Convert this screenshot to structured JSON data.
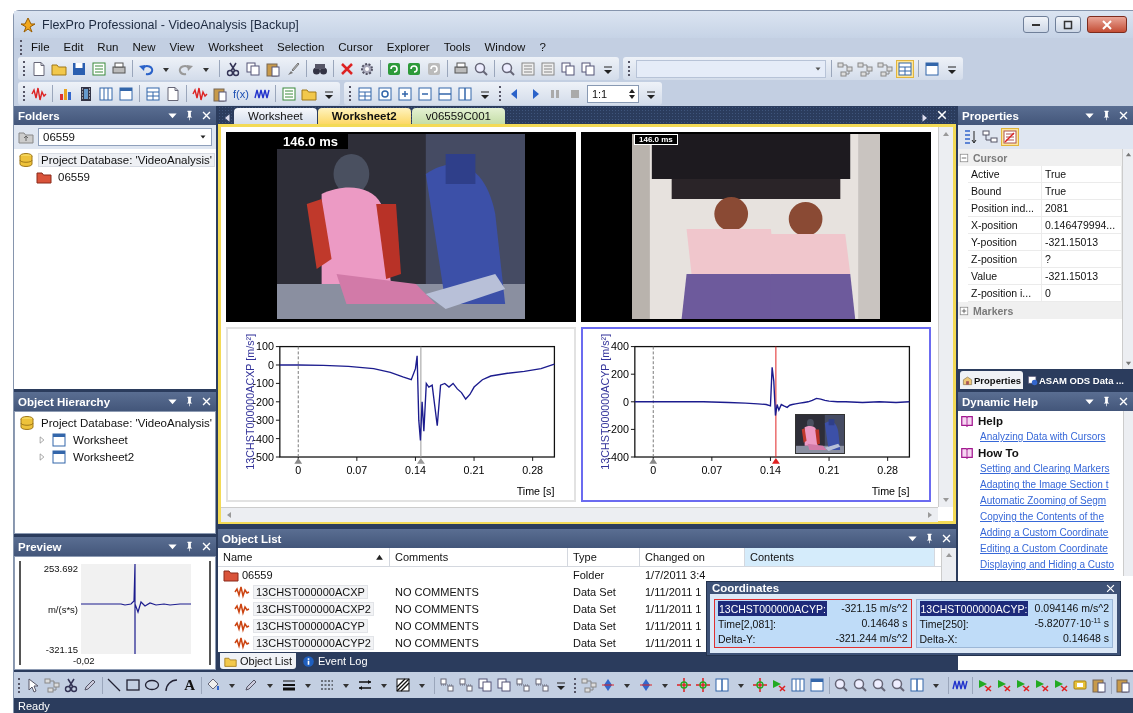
{
  "window": {
    "title": "FlexPro Professional - VideoAnalysis [Backup]"
  },
  "menu": [
    "File",
    "Edit",
    "Run",
    "New",
    "View",
    "Worksheet",
    "Selection",
    "Cursor",
    "Explorer",
    "Tools",
    "Window",
    "?"
  ],
  "toolbar": {
    "formula_button": "f(x)",
    "zoom_ratio": "1:1"
  },
  "folders": {
    "title": "Folders",
    "path": "06559",
    "tree": [
      {
        "label": "Project Database: 'VideoAnalysis'",
        "kind": "database",
        "selected": true,
        "children": [
          {
            "label": "06559",
            "kind": "folder",
            "selected": false
          }
        ]
      }
    ]
  },
  "object_hierarchy": {
    "title": "Object Hierarchy",
    "tree": [
      {
        "label": "Project Database: 'VideoAnalysis'",
        "kind": "database",
        "children": [
          {
            "label": "Worksheet",
            "kind": "worksheet",
            "expanded": false
          },
          {
            "label": "Worksheet2",
            "kind": "worksheet",
            "expanded": false
          }
        ]
      }
    ]
  },
  "preview": {
    "title": "Preview",
    "y_max": "253.692",
    "y_unit": "m/(s*s)",
    "y_min": "-321.15",
    "x_min": "-0,02"
  },
  "document_tabs": [
    {
      "label": "Worksheet",
      "kind": "worksheet",
      "selected": false
    },
    {
      "label": "Worksheet2",
      "kind": "worksheet",
      "selected": true
    },
    {
      "label": "v06559C001",
      "kind": "video",
      "selected": false
    }
  ],
  "worksheet": {
    "videos": [
      {
        "time": "146.0 ms"
      },
      {
        "time": "146.0 ms"
      }
    ],
    "charts": [
      {
        "selected": false,
        "chart_data": {
          "type": "line",
          "xlabel": "Time [s]",
          "ylabel": "13CHST000000ACXP [m/s²]",
          "xlim": [
            -0.022,
            0.306
          ],
          "ylim": [
            -500,
            100
          ],
          "xticks": [
            0,
            0.07,
            0.14,
            0.21,
            0.28
          ],
          "yticks": [
            -500,
            -400,
            -300,
            -200,
            -100,
            0,
            100
          ],
          "x": [
            -0.022,
            0,
            0.03,
            0.06,
            0.09,
            0.11,
            0.125,
            0.135,
            0.14,
            0.142,
            0.144,
            0.146,
            0.148,
            0.15,
            0.153,
            0.156,
            0.16,
            0.163,
            0.166,
            0.17,
            0.175,
            0.18,
            0.185,
            0.19,
            0.195,
            0.2,
            0.205,
            0.21,
            0.22,
            0.23,
            0.25,
            0.27,
            0.29,
            0.306
          ],
          "ref_lines": [
            {
              "axis": "x",
              "value": 0.1465
            }
          ],
          "series": [
            {
              "color": "#1c1c8e",
              "values": [
                0,
                0,
                -2,
                -8,
                -20,
                -40,
                -65,
                -80,
                -20,
                50,
                -300,
                -410,
                -200,
                -360,
                -100,
                -120,
                -110,
                -220,
                -330,
                -110,
                -100,
                -120,
                -100,
                -130,
                -150,
                -185,
                -160,
                -120,
                -80,
                -60,
                -45,
                -35,
                -20,
                5
              ]
            }
          ]
        }
      },
      {
        "selected": true,
        "chart_data": {
          "type": "line",
          "xlabel": "Time [s]",
          "ylabel": "13CHST000000ACYP [m/s²]",
          "xlim": [
            -0.022,
            0.306
          ],
          "ylim": [
            -400,
            400
          ],
          "xticks": [
            0,
            0.07,
            0.14,
            0.21,
            0.28
          ],
          "yticks": [
            -400,
            -200,
            0,
            200,
            400
          ],
          "x": [
            -0.022,
            0,
            0.03,
            0.06,
            0.09,
            0.11,
            0.125,
            0.135,
            0.14,
            0.142,
            0.144,
            0.146,
            0.148,
            0.15,
            0.153,
            0.156,
            0.16,
            0.163,
            0.166,
            0.17,
            0.175,
            0.18,
            0.185,
            0.19,
            0.195,
            0.2,
            0.205,
            0.21,
            0.22,
            0.23,
            0.25,
            0.27,
            0.29,
            0.306
          ],
          "ref_lines": [
            {
              "axis": "x",
              "value": 0.1465
            }
          ],
          "series": [
            {
              "color": "#1c1c8e",
              "values": [
                0,
                0,
                0,
                0,
                -5,
                -10,
                -15,
                -20,
                -30,
                250,
                150,
                -100,
                -20,
                -60,
                -20,
                -30,
                -40,
                -25,
                -20,
                -15,
                -10,
                -5,
                0,
                10,
                25,
                20,
                10,
                5,
                0,
                0,
                -5,
                0,
                -5,
                0
              ]
            }
          ]
        }
      }
    ]
  },
  "object_list": {
    "title": "Object List",
    "columns": [
      {
        "label": "Name",
        "sorted": true,
        "selected": false
      },
      {
        "label": "Comments",
        "sorted": false,
        "selected": false
      },
      {
        "label": "Type",
        "sorted": false,
        "selected": false
      },
      {
        "label": "Changed on",
        "sorted": false,
        "selected": false
      },
      {
        "label": "Contents",
        "sorted": false,
        "selected": true
      }
    ],
    "rows": [
      {
        "kind": "folder",
        "name": "06559",
        "type": "Folder",
        "changed": "1/7/2011 3:4"
      },
      {
        "kind": "dataset",
        "name": "13CHST000000ACXP",
        "comments": "NO COMMENTS",
        "type": "Data Set",
        "changed": "1/11/2011 1"
      },
      {
        "kind": "dataset",
        "name": "13CHST000000ACXP2",
        "comments": "NO COMMENTS",
        "type": "Data Set",
        "changed": "1/11/2011 1"
      },
      {
        "kind": "dataset",
        "name": "13CHST000000ACYP",
        "comments": "NO COMMENTS",
        "type": "Data Set",
        "changed": "1/11/2011 1"
      },
      {
        "kind": "dataset",
        "name": "13CHST000000ACYP2",
        "comments": "NO COMMENTS",
        "type": "Data Set",
        "changed": "1/11/2011 1"
      }
    ]
  },
  "bottom_tabs": [
    {
      "label": "Object List",
      "kind": "list",
      "selected": true
    },
    {
      "label": "Event Log",
      "kind": "log",
      "selected": false
    }
  ],
  "properties": {
    "title": "Properties",
    "groups": [
      {
        "label": "Cursor",
        "expanded": true,
        "rows": [
          {
            "name": "Active",
            "value": "True"
          },
          {
            "name": "Bound",
            "value": "True"
          },
          {
            "name": "Position ind...",
            "value": "2081"
          },
          {
            "name": "X-position",
            "value": "0.146479994..."
          },
          {
            "name": "Y-position",
            "value": "-321.15013"
          },
          {
            "name": "Z-position",
            "value": "?"
          },
          {
            "name": "Value",
            "value": "-321.15013"
          },
          {
            "name": "Z-position i...",
            "value": "0"
          }
        ]
      },
      {
        "label": "Markers",
        "expanded": false
      }
    ]
  },
  "right_tabs": [
    {
      "label": "Properties",
      "selected": true
    },
    {
      "label": "ASAM ODS Data ...",
      "selected": false
    }
  ],
  "dynamic_help": {
    "title": "Dynamic Help",
    "sections": [
      {
        "heading": "Help",
        "links": [
          "Analyzing Data with Cursors"
        ]
      },
      {
        "heading": "How To",
        "links": [
          "Setting and Clearing Markers",
          "Adapting the Image Section t",
          "Automatic Zooming of Segm",
          "Copying the Contents of the",
          "Adding a Custom Coordinate",
          "Editing a Custom Coordinate",
          "Displaying and Hiding a Custo"
        ]
      }
    ]
  },
  "coordinates": {
    "title": "Coordinates",
    "cursors": [
      {
        "selected": true,
        "channel": "13CHST000000ACYP:",
        "value": "-321.15 m/s^2",
        "time_label": "Time[2,081]:",
        "time": "0.14648 s",
        "delta_label": "Delta-Y:",
        "delta": "-321.244 m/s^2"
      },
      {
        "selected": false,
        "channel": "13CHST000000ACYP:",
        "value": "0.094146 m/s^2",
        "time_label": "Time[250]:",
        "time": "-5.82077·10$^{-11}$ s",
        "delta_label": "Delta-X:",
        "delta": "0.14648 s"
      }
    ]
  },
  "draw_toolbar": {
    "text_tool": "A"
  },
  "status_bar": {
    "text": "Ready"
  }
}
